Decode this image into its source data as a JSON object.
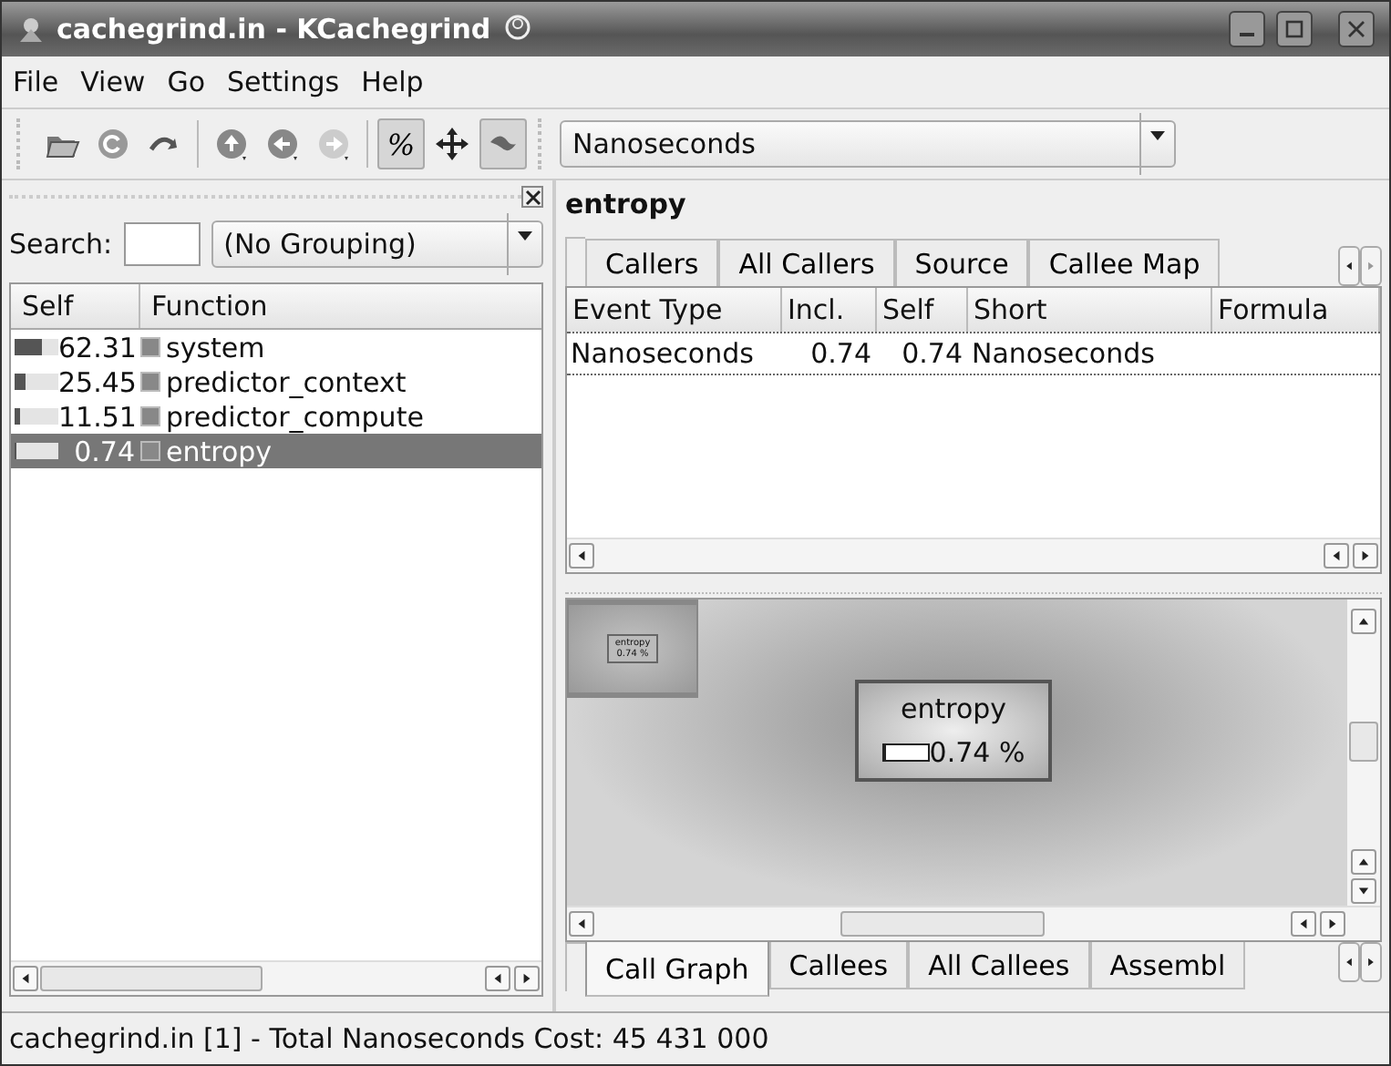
{
  "window": {
    "title": "cachegrind.in - KCachegrind"
  },
  "menu": [
    "File",
    "View",
    "Go",
    "Settings",
    "Help"
  ],
  "toolbar": [
    {
      "kind": "open",
      "pressed": false
    },
    {
      "kind": "reload",
      "pressed": false
    },
    {
      "kind": "redo",
      "pressed": false
    },
    {
      "kind": "sep"
    },
    {
      "kind": "up",
      "pressed": false
    },
    {
      "kind": "back",
      "pressed": false
    },
    {
      "kind": "next",
      "pressed": false
    },
    {
      "kind": "sep"
    },
    {
      "kind": "text",
      "label": "%",
      "pressed": true
    },
    {
      "kind": "move",
      "pressed": false
    },
    {
      "kind": "cycle",
      "pressed": true
    }
  ],
  "event_type": {
    "value": "Nanoseconds"
  },
  "sidebar": {
    "search_label": "Search:",
    "grouping": "(No Grouping)",
    "columns": [
      "Self",
      "Function"
    ],
    "rows": [
      {
        "self": "62.31",
        "function": "system",
        "level": 0.6231,
        "selected": false
      },
      {
        "self": "25.45",
        "function": "predictor_context",
        "level": 0.2545,
        "selected": false
      },
      {
        "self": "11.51",
        "function": "predictor_compute",
        "level": 0.1151,
        "selected": false
      },
      {
        "self": "0.74",
        "function": "entropy",
        "level": 0.0074,
        "selected": true
      }
    ]
  },
  "detail": {
    "title": "entropy",
    "tabs": [
      {
        "label": "Callers",
        "selected": false
      },
      {
        "label": "All Callers",
        "selected": false
      },
      {
        "label": "Source",
        "selected": false
      },
      {
        "label": "Callee Map",
        "selected": false
      }
    ],
    "table": {
      "columns": [
        "Event Type",
        "Incl.",
        "Self",
        "Short",
        "Formula"
      ],
      "rows": [
        [
          "Nanoseconds",
          "0.74",
          "0.74",
          "Nanoseconds",
          ""
        ]
      ]
    },
    "graph": {
      "node": {
        "name": "entropy",
        "cost": "0.74 %",
        "level": 0.0074
      },
      "overview": {
        "name": "entropy",
        "cost": "0.74 %"
      }
    },
    "bottom_tabs": [
      {
        "label": "Call Graph",
        "selected": true
      },
      {
        "label": "Callees",
        "selected": false
      },
      {
        "label": "All Callees",
        "selected": false
      },
      {
        "label": "Assembl",
        "selected": false
      }
    ]
  },
  "status_bar": "cachegrind.in [1] - Total Nanoseconds Cost:  45 431 000"
}
